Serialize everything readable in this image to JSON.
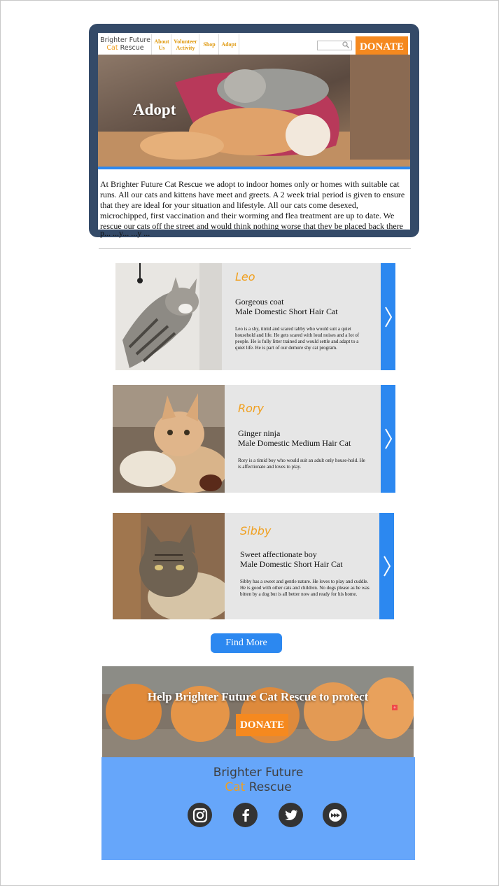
{
  "header": {
    "brand_line1": "Brighter Future",
    "brand_cat": "Cat",
    "brand_rescue": "Rescue",
    "nav": [
      {
        "label_1": "About",
        "label_2": "Us"
      },
      {
        "label_1": "Volunteer",
        "label_2": "Activity"
      },
      {
        "label_1": "Shop",
        "label_2": ""
      },
      {
        "label_1": "Adopt",
        "label_2": ""
      }
    ],
    "search_placeholder": "",
    "donate_label": "DONATE"
  },
  "hero": {
    "title": "Adopt"
  },
  "intro": {
    "text": "At Brighter Future Cat Rescue we adopt to indoor homes only or homes with suitable cat runs. All our cats and kittens have meet and greets. A 2 week trial period is given to ensure that they are ideal for your situation and lifestyle. All our cats come desexed, microchipped, first vaccination and their worming and flea treatment are up to date. We rescue our cats off the street and would think nothing worse that they be placed back there and in danger of the",
    "overflow_text": "p... ...y... ...y ..."
  },
  "cats": [
    {
      "name": "Leo",
      "tagline": "Gorgeous coat",
      "breed": "Male Domestic Short Hair Cat",
      "description": "Leo is a shy, timid and scared tabby who would suit a quiet household and life. He gets scared with loud noises and a lot of people. He is fully litter trained and would settle and adapt to a quiet life. He is part of our demure shy cat program."
    },
    {
      "name": "Rory",
      "tagline": "Ginger ninja",
      "breed": "Male Domestic Medium Hair Cat",
      "description": "Rory is a timid boy who would suit an adult only house-hold. He is affectionate and loves to play."
    },
    {
      "name": "Sibby",
      "tagline": "Sweet affectionate boy",
      "breed": "Male Domestic Short Hair Cat",
      "description": "Sibby has a sweet and gentle nature. He loves to play and cuddle. He is good with other cats and children. No dogs please as he was bitten by a dog but is all better now and ready for his home."
    }
  ],
  "find_more_label": "Find More",
  "banner": {
    "text": "Help Brighter Future Cat Rescue to protect",
    "donate_label": "DONATE",
    "badge": "+"
  },
  "footer": {
    "brand_line1": "Brighter Future",
    "brand_cat": "Cat",
    "brand_rescue": "Rescue",
    "social_icons": [
      "instagram-icon",
      "facebook-icon",
      "twitter-icon",
      "more-icon"
    ]
  },
  "colors": {
    "accent_blue": "#2c88f0",
    "donate_orange": "#f5891f",
    "brand_gold": "#f0a020",
    "frame": "#344a68",
    "footer_bg": "#66a6fa"
  }
}
